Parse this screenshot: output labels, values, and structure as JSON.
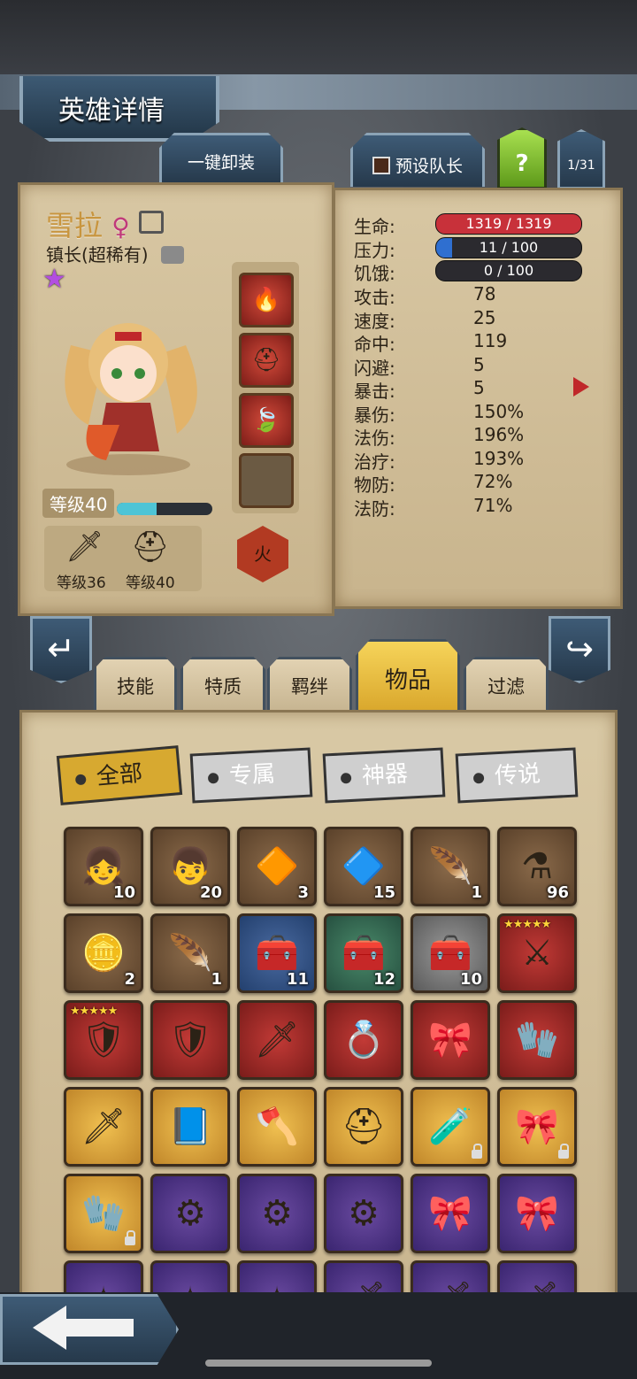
{
  "header": {
    "title": "英雄详情"
  },
  "top_buttons": {
    "unequip_all": "一键卸装",
    "preset_leader": "预设队长",
    "help": "?",
    "page_counter": "1/31"
  },
  "hero": {
    "name": "雪拉",
    "gender_symbol": "♀",
    "class": "镇长(超稀有)",
    "level_label": "等级40",
    "xp_fraction": 0.42,
    "element": "火",
    "weapon_level": "等级36",
    "armor_level": "等级40"
  },
  "stats": {
    "hp": {
      "label": "生命:",
      "value": "1319 / 1319",
      "fraction": 1.0,
      "color": "#c8313a"
    },
    "stress": {
      "label": "压力:",
      "value": "11 / 100",
      "fraction": 0.11,
      "color": "#2f6fd0"
    },
    "hunger": {
      "label": "饥饿:",
      "value": "0 / 100",
      "fraction": 0.0,
      "color": "#777777"
    },
    "rows": [
      {
        "label": "攻击:",
        "value": "78"
      },
      {
        "label": "速度:",
        "value": "25"
      },
      {
        "label": "命中:",
        "value": "119"
      },
      {
        "label": "闪避:",
        "value": "5"
      },
      {
        "label": "暴击:",
        "value": "5"
      },
      {
        "label": "暴伤:",
        "value": "150%"
      },
      {
        "label": "法伤:",
        "value": "196%"
      },
      {
        "label": "治疗:",
        "value": "193%"
      },
      {
        "label": "物防:",
        "value": "72%"
      },
      {
        "label": "法防:",
        "value": "71%"
      }
    ]
  },
  "tabs": [
    "技能",
    "特质",
    "羁绊",
    "物品",
    "过滤"
  ],
  "active_tab": "物品",
  "filters": [
    "全部",
    "专属",
    "神器",
    "传说"
  ],
  "active_filter": "全部",
  "items": [
    {
      "icon": "hero-portrait-blonde-icon",
      "count": "10",
      "bg": "brown"
    },
    {
      "icon": "hero-portrait-redhair-icon",
      "count": "20",
      "bg": "brown"
    },
    {
      "icon": "fire-gem-icon",
      "count": "3",
      "bg": "brown"
    },
    {
      "icon": "blue-rune-icon",
      "count": "15",
      "bg": "brown"
    },
    {
      "icon": "golden-feather-icon",
      "count": "1",
      "bg": "brown"
    },
    {
      "icon": "potion-flask-icon",
      "count": "96",
      "bg": "brown"
    },
    {
      "icon": "golden-coin-icon",
      "count": "2",
      "bg": "brown"
    },
    {
      "icon": "white-feather-icon",
      "count": "1",
      "bg": "brown"
    },
    {
      "icon": "treasure-chest-icon",
      "count": "11",
      "bg": "blue"
    },
    {
      "icon": "treasure-chest-icon",
      "count": "12",
      "bg": "green"
    },
    {
      "icon": "treasure-chest-icon",
      "count": "10",
      "bg": "grey"
    },
    {
      "icon": "scythe-weapon-icon",
      "count": "",
      "bg": "red",
      "stars": "★★★★★"
    },
    {
      "icon": "warrior-armor-icon",
      "count": "",
      "bg": "red",
      "stars": "★★★★★"
    },
    {
      "icon": "shield-emblem-icon",
      "count": "",
      "bg": "red"
    },
    {
      "icon": "crystal-sword-icon",
      "count": "",
      "bg": "red"
    },
    {
      "icon": "jeweled-ring-icon",
      "count": "",
      "bg": "red"
    },
    {
      "icon": "red-scarf-icon",
      "count": "",
      "bg": "red"
    },
    {
      "icon": "magic-gauntlet-icon",
      "count": "",
      "bg": "red"
    },
    {
      "icon": "great-sword-icon",
      "count": "",
      "bg": "gold"
    },
    {
      "icon": "spell-book-icon",
      "count": "",
      "bg": "gold"
    },
    {
      "icon": "heart-axe-icon",
      "count": "",
      "bg": "gold"
    },
    {
      "icon": "blue-helmet-icon",
      "count": "",
      "bg": "gold"
    },
    {
      "icon": "silver-bottle-icon",
      "count": "",
      "bg": "gold",
      "locked": true
    },
    {
      "icon": "red-scarf-icon",
      "count": "",
      "bg": "gold",
      "locked": true
    },
    {
      "icon": "dark-gauntlet-icon",
      "count": "",
      "bg": "gold",
      "locked": true
    },
    {
      "icon": "spiked-collar-icon",
      "count": "",
      "bg": "purple"
    },
    {
      "icon": "spiked-collar-icon",
      "count": "",
      "bg": "purple"
    },
    {
      "icon": "spiked-collar-icon",
      "count": "",
      "bg": "purple"
    },
    {
      "icon": "red-scarf-icon",
      "count": "",
      "bg": "purple"
    },
    {
      "icon": "red-scarf-icon",
      "count": "",
      "bg": "purple"
    },
    {
      "icon": "blue-crystal-icon",
      "count": "",
      "bg": "purple"
    },
    {
      "icon": "blue-crystal-icon",
      "count": "",
      "bg": "purple"
    },
    {
      "icon": "blue-crystal-icon",
      "count": "",
      "bg": "purple"
    },
    {
      "icon": "steel-blade-icon",
      "count": "",
      "bg": "purple"
    },
    {
      "icon": "steel-blade-icon",
      "count": "",
      "bg": "purple"
    },
    {
      "icon": "steel-blade-icon",
      "count": "",
      "bg": "purple"
    }
  ],
  "icon_glyphs": {
    "hero-portrait-blonde-icon": "👧",
    "hero-portrait-redhair-icon": "👦",
    "fire-gem-icon": "🔶",
    "blue-rune-icon": "🔷",
    "golden-feather-icon": "🪶",
    "potion-flask-icon": "⚗",
    "golden-coin-icon": "🪙",
    "white-feather-icon": "🪶",
    "treasure-chest-icon": "🧰",
    "scythe-weapon-icon": "⚔",
    "warrior-armor-icon": "🛡",
    "shield-emblem-icon": "🛡",
    "crystal-sword-icon": "🗡",
    "jeweled-ring-icon": "💍",
    "red-scarf-icon": "🎀",
    "magic-gauntlet-icon": "🧤",
    "great-sword-icon": "🗡",
    "spell-book-icon": "📘",
    "heart-axe-icon": "🪓",
    "blue-helmet-icon": "⛑",
    "silver-bottle-icon": "🧪",
    "dark-gauntlet-icon": "🧤",
    "spiked-collar-icon": "⚙",
    "blue-crystal-icon": "✦",
    "steel-blade-icon": "🗡"
  }
}
